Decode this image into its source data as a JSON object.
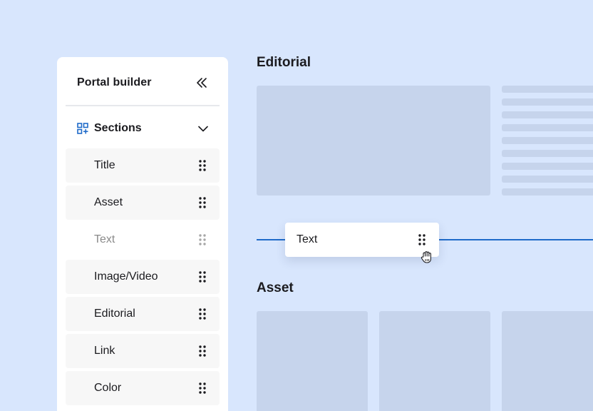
{
  "sidebar": {
    "title": "Portal builder",
    "collapse_icon": "double-chevron-left-icon",
    "sections": {
      "label": "Sections",
      "icon": "grid-add-icon",
      "toggle_icon": "chevron-down-icon",
      "expanded": true
    },
    "items": [
      {
        "label": "Title",
        "state": "normal"
      },
      {
        "label": "Asset",
        "state": "normal"
      },
      {
        "label": "Text",
        "state": "ghost"
      },
      {
        "label": "Image/Video",
        "state": "normal"
      },
      {
        "label": "Editorial",
        "state": "normal"
      },
      {
        "label": "Link",
        "state": "normal"
      },
      {
        "label": "Color",
        "state": "normal"
      }
    ]
  },
  "canvas": {
    "editorial_heading": "Editorial",
    "asset_heading": "Asset",
    "drag_item": {
      "label": "Text",
      "icon": "drag-grip-icon"
    },
    "cursor_icon": "grab-hand-icon"
  },
  "colors": {
    "background": "#d8e6fd",
    "placeholder": "#c6d4ec",
    "accent": "#1f6bc9",
    "panel": "#ffffff",
    "item": "#f7f7f7"
  }
}
